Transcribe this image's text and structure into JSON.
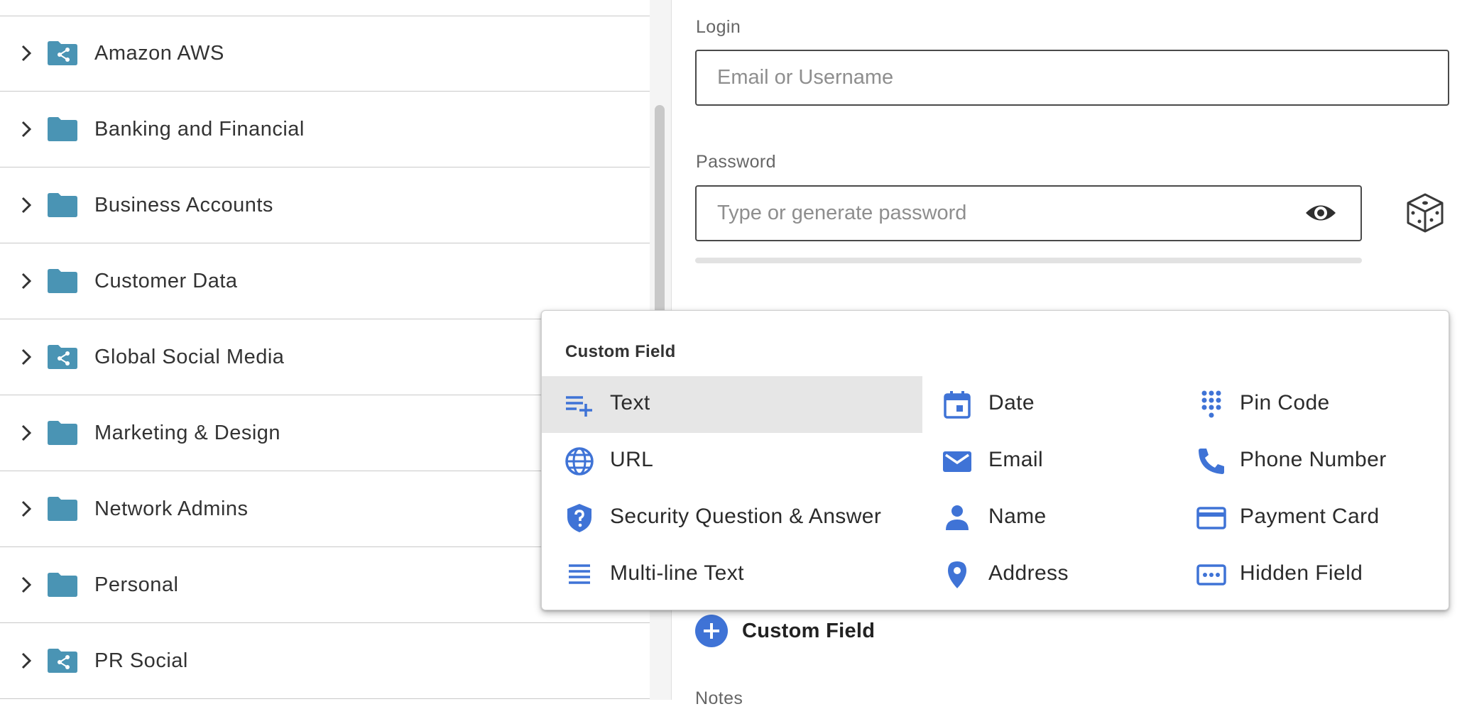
{
  "folders": [
    {
      "label": "Amazon AWS",
      "icon": "shared-folder-icon"
    },
    {
      "label": "Banking and Financial",
      "icon": "folder-icon"
    },
    {
      "label": "Business Accounts",
      "icon": "folder-icon"
    },
    {
      "label": "Customer Data",
      "icon": "folder-icon"
    },
    {
      "label": "Global Social Media",
      "icon": "shared-folder-icon"
    },
    {
      "label": "Marketing & Design",
      "icon": "folder-icon"
    },
    {
      "label": "Network Admins",
      "icon": "folder-icon"
    },
    {
      "label": "Personal",
      "icon": "folder-icon"
    },
    {
      "label": "PR Social",
      "icon": "shared-folder-icon"
    }
  ],
  "form": {
    "login_label": "Login",
    "login_placeholder": "Email or Username",
    "login_value": "",
    "password_label": "Password",
    "password_placeholder": "Type or generate password",
    "password_value": "",
    "password_strength": 0,
    "add_custom_field_label": "Custom Field",
    "notes_label": "Notes"
  },
  "menu": {
    "title": "Custom Field",
    "items": [
      {
        "label": "Text",
        "icon": "text-add-icon",
        "active": true
      },
      {
        "label": "Date",
        "icon": "calendar-icon"
      },
      {
        "label": "Pin Code",
        "icon": "dialpad-icon"
      },
      {
        "label": "URL",
        "icon": "globe-icon"
      },
      {
        "label": "Email",
        "icon": "envelope-icon"
      },
      {
        "label": "Phone Number",
        "icon": "phone-icon"
      },
      {
        "label": "Security Question & Answer",
        "icon": "shield-question-icon"
      },
      {
        "label": "Name",
        "icon": "person-icon"
      },
      {
        "label": "Payment Card",
        "icon": "credit-card-icon"
      },
      {
        "label": "Multi-line Text",
        "icon": "lines-icon"
      },
      {
        "label": "Address",
        "icon": "map-pin-icon"
      },
      {
        "label": "Hidden Field",
        "icon": "hidden-field-icon"
      }
    ]
  },
  "colors": {
    "folder": "#4a94b4",
    "accent": "#3f73d6",
    "active_item_bg": "#e6e6e6"
  }
}
